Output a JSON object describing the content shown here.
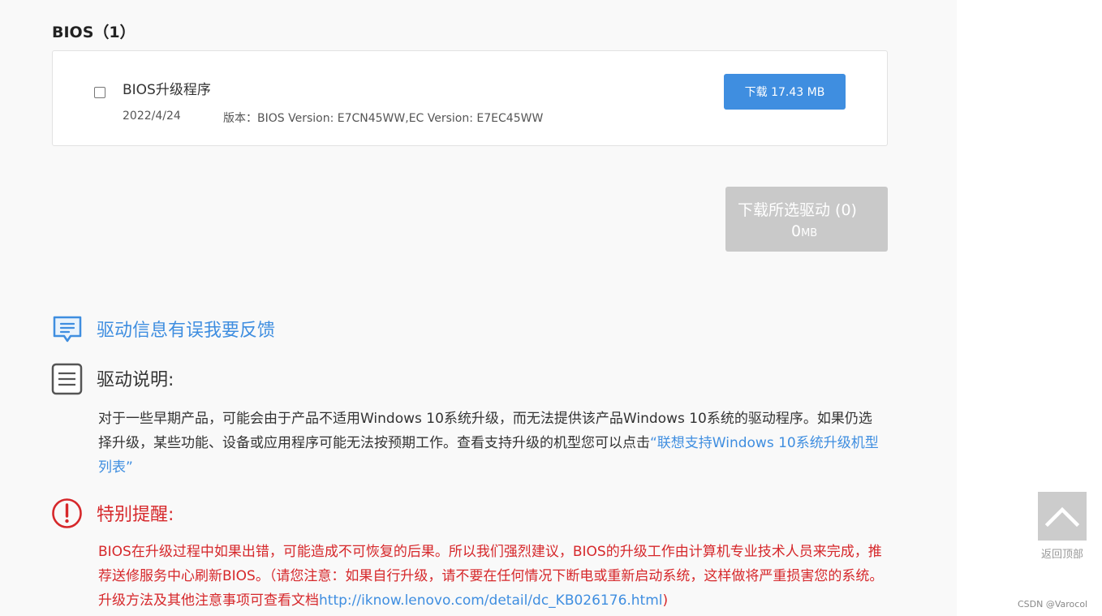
{
  "section": {
    "title": "BIOS（1）"
  },
  "driver": {
    "name": "BIOS升级程序",
    "date": "2022/4/24",
    "version_label": "版本：",
    "version": "BIOS Version: E7CN45WW,EC Version: E7EC45WW",
    "download_label": "下载 17.43 MB"
  },
  "download_selected": {
    "label": "下载所选驱动 (0)",
    "size": "0",
    "unit": "MB"
  },
  "feedback": {
    "label": "驱动信息有误我要反馈",
    "icon": "feedback-icon"
  },
  "description": {
    "title": "驱动说明:",
    "icon": "document-icon",
    "body_text": "对于一些早期产品，可能会由于产品不适用Windows 10系统升级，而无法提供该产品Windows 10系统的驱动程序。如果仍选择升级，某些功能、设备或应用程序可能无法按预期工作。查看支持升级的机型您可以点击",
    "link_text": "“联想支持Windows 10系统升级机型列表”"
  },
  "warning": {
    "title": "特别提醒:",
    "icon": "warning-icon",
    "body_text": "BIOS在升级过程中如果出错，可能造成不可恢复的后果。所以我们强烈建议，BIOS的升级工作由计算机专业技术人员来完成，推荐送修服务中心刷新BIOS。（请您注意：如果自行升级，请不要在任何情况下断电或重新启动系统，这样做将严重损害您的系统。升级方法及其他注意事项可查看文档",
    "link_text": "http://iknow.lenovo.com/detail/dc_KB026176.html",
    "body_tail": ")"
  },
  "back_to_top": {
    "label": "返回顶部",
    "icon": "chevron-up-icon"
  },
  "watermark": "CSDN @Varocol",
  "colors": {
    "accent": "#3f8ee0",
    "warning": "#d6282b",
    "disabled": "#c9c9c9"
  }
}
